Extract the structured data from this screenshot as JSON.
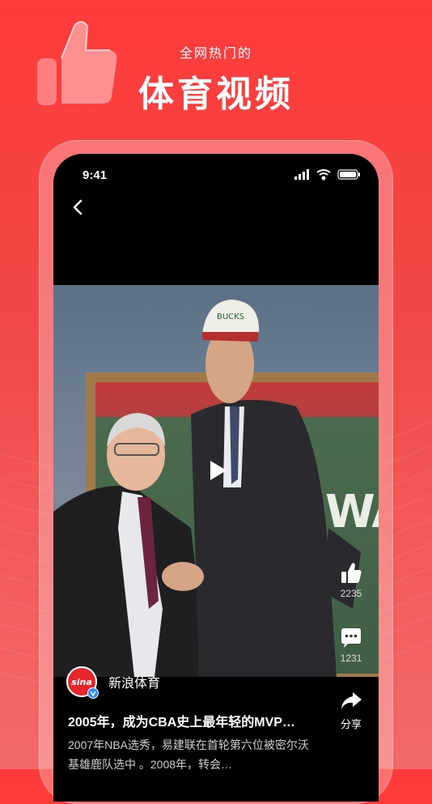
{
  "promo": {
    "subtitle": "全网热门的",
    "title": "体育视频"
  },
  "status_bar": {
    "time": "9:41"
  },
  "video": {
    "board_text": "WA",
    "cap_text": "BUCKS",
    "likes": "2235",
    "comments": "1231",
    "share_label": "分享",
    "author": "新浪体育",
    "author_logo_text": "sina",
    "title": "2005年，成为CBA史上最年轻的MVP…",
    "description": "2007年NBA选秀，易建联在首轮第六位被密尔沃基雄鹿队选中 。2008年，转会…"
  },
  "icons": [
    "thumbs-up-icon",
    "back-arrow-icon",
    "signal-icon",
    "wifi-icon",
    "battery-icon",
    "play-icon",
    "like-icon",
    "comment-icon",
    "share-icon",
    "verified-icon"
  ],
  "colors": {
    "brand_red": "#ff3b3b",
    "screen_bg": "#000000",
    "verified_blue": "#2a8cff",
    "sina_red": "#e5262a"
  }
}
